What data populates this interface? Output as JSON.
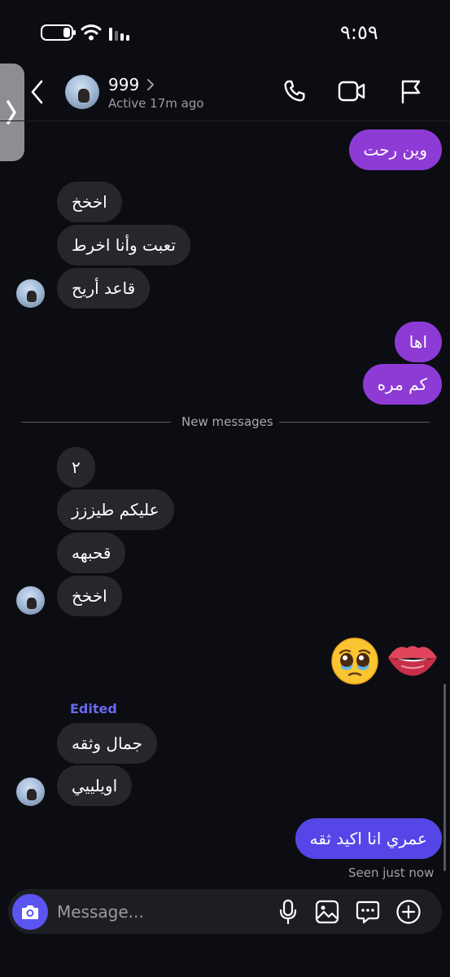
{
  "status_bar": {
    "time": "٩:٥٩"
  },
  "header": {
    "contact_name": "999",
    "contact_status": "Active 17m ago"
  },
  "messages": {
    "m1": "وين رحت",
    "m2": "اخخخ",
    "m3": "تعبت وأنا اخرط",
    "m4": "قاعد أريح",
    "m5": "اها",
    "m6": "كم مره",
    "m7": "٢",
    "m8": "عليكم طيززز",
    "m9": "قحبهه",
    "m10": "اخخخ",
    "m11": "جمال وثقه",
    "m12": "اويلييي",
    "m13": "عمري انا اكيد ثقه"
  },
  "divider": {
    "label": "New messages"
  },
  "edited_label": "Edited",
  "seen_label": "Seen just now",
  "composer": {
    "placeholder": "Message..."
  },
  "icons": {
    "back": "chevron-left-icon",
    "side_handle": "chevron-right-icon",
    "call": "phone-icon",
    "video": "video-camera-icon",
    "report": "flag-icon",
    "camera": "camera-icon",
    "mic": "microphone-icon",
    "gallery": "image-icon",
    "chat": "chat-bubble-icon",
    "add": "plus-circle-icon",
    "emoji_1": "pleading-face-emoji",
    "emoji_2": "biting-lip-emoji"
  },
  "colors": {
    "background": "#0c0d12",
    "received_bubble": "#26272c",
    "sent_purple": "#8e3bd6",
    "sent_blue": "#5646e8",
    "accent": "#5a55f0"
  }
}
